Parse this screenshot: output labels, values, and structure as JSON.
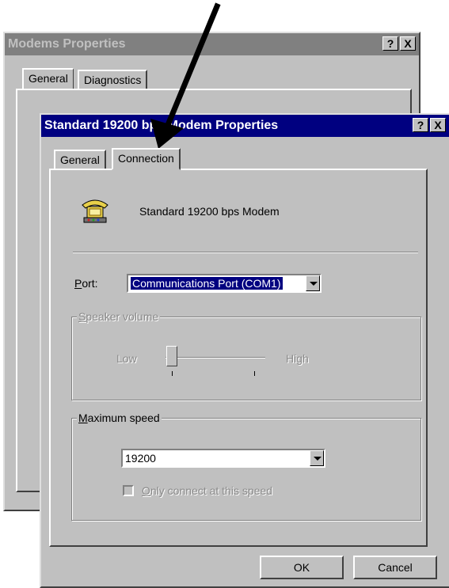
{
  "back_window": {
    "title": "Modems Properties",
    "tabs": [
      "General",
      "Diagnostics"
    ],
    "help_glyph": "?",
    "close_glyph": "X"
  },
  "front_window": {
    "title": "Standard 19200 bps Modem Properties",
    "help_glyph": "?",
    "close_glyph": "X",
    "tabs": [
      "General",
      "Connection"
    ],
    "device_name": "Standard 19200 bps Modem",
    "device_icon": "telephone-modem-icon",
    "port": {
      "label_accel": "P",
      "label_rest": "ort:",
      "value": "Communications Port (COM1)"
    },
    "speaker_volume": {
      "legend_accel": "S",
      "legend_rest": "peaker volume",
      "low_label": "Low",
      "high_label": "High",
      "level": 0,
      "enabled": false
    },
    "maximum_speed": {
      "legend_accel": "M",
      "legend_rest": "aximum speed",
      "value": "19200",
      "only_connect_accel": "O",
      "only_connect_rest": "nly connect at this speed",
      "only_connect_checked": false
    },
    "buttons": {
      "ok": "OK",
      "cancel": "Cancel"
    }
  },
  "annotation": {
    "type": "arrow",
    "color": "#000000"
  }
}
